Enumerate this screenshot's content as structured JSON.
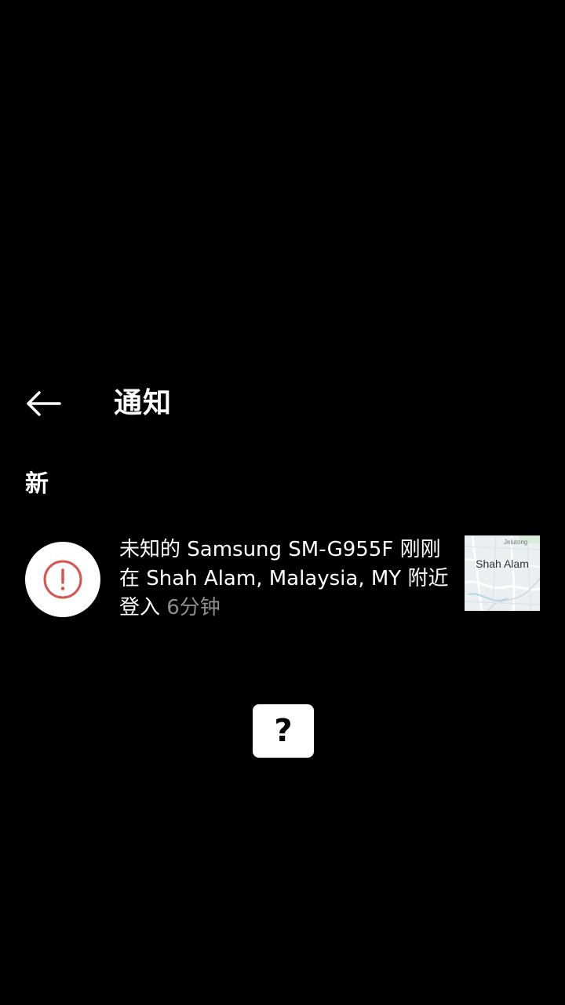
{
  "header": {
    "title": "通知"
  },
  "section": {
    "label": "新"
  },
  "notification": {
    "message": "未知的 Samsung SM-G955F 刚刚在 Shah Alam, Malaysia, MY 附近登入 ",
    "time": "6分钟",
    "icon": "alert-circle-icon",
    "icon_color": "#d9534f",
    "map": {
      "label": "Shah Alam",
      "small_label": "Jelutong"
    }
  },
  "help_button": {
    "label": "?"
  }
}
